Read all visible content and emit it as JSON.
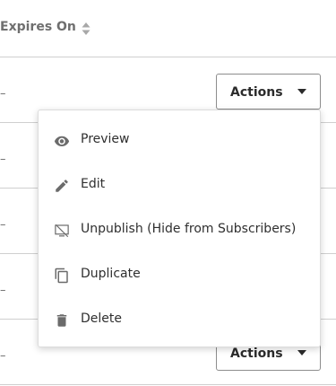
{
  "header": {
    "column_label": "Expires On"
  },
  "rows": [
    {
      "expires": "–",
      "actions_label": "Actions"
    },
    {
      "expires": "–"
    },
    {
      "expires": "–"
    },
    {
      "expires": "–"
    },
    {
      "expires": "–",
      "actions_label": "Actions"
    }
  ],
  "menu": {
    "items": [
      {
        "label": "Preview",
        "icon": "eye-icon"
      },
      {
        "label": "Edit",
        "icon": "pencil-icon"
      },
      {
        "label": "Unpublish (Hide from Subscribers)",
        "icon": "hidden-screen-icon"
      },
      {
        "label": "Duplicate",
        "icon": "copy-icon"
      },
      {
        "label": "Delete",
        "icon": "trash-icon"
      }
    ]
  },
  "colors": {
    "text": "#2f2f2f",
    "muted": "#6f6f6f",
    "icon": "#6b6b6b",
    "divider": "#cfcfcf"
  }
}
